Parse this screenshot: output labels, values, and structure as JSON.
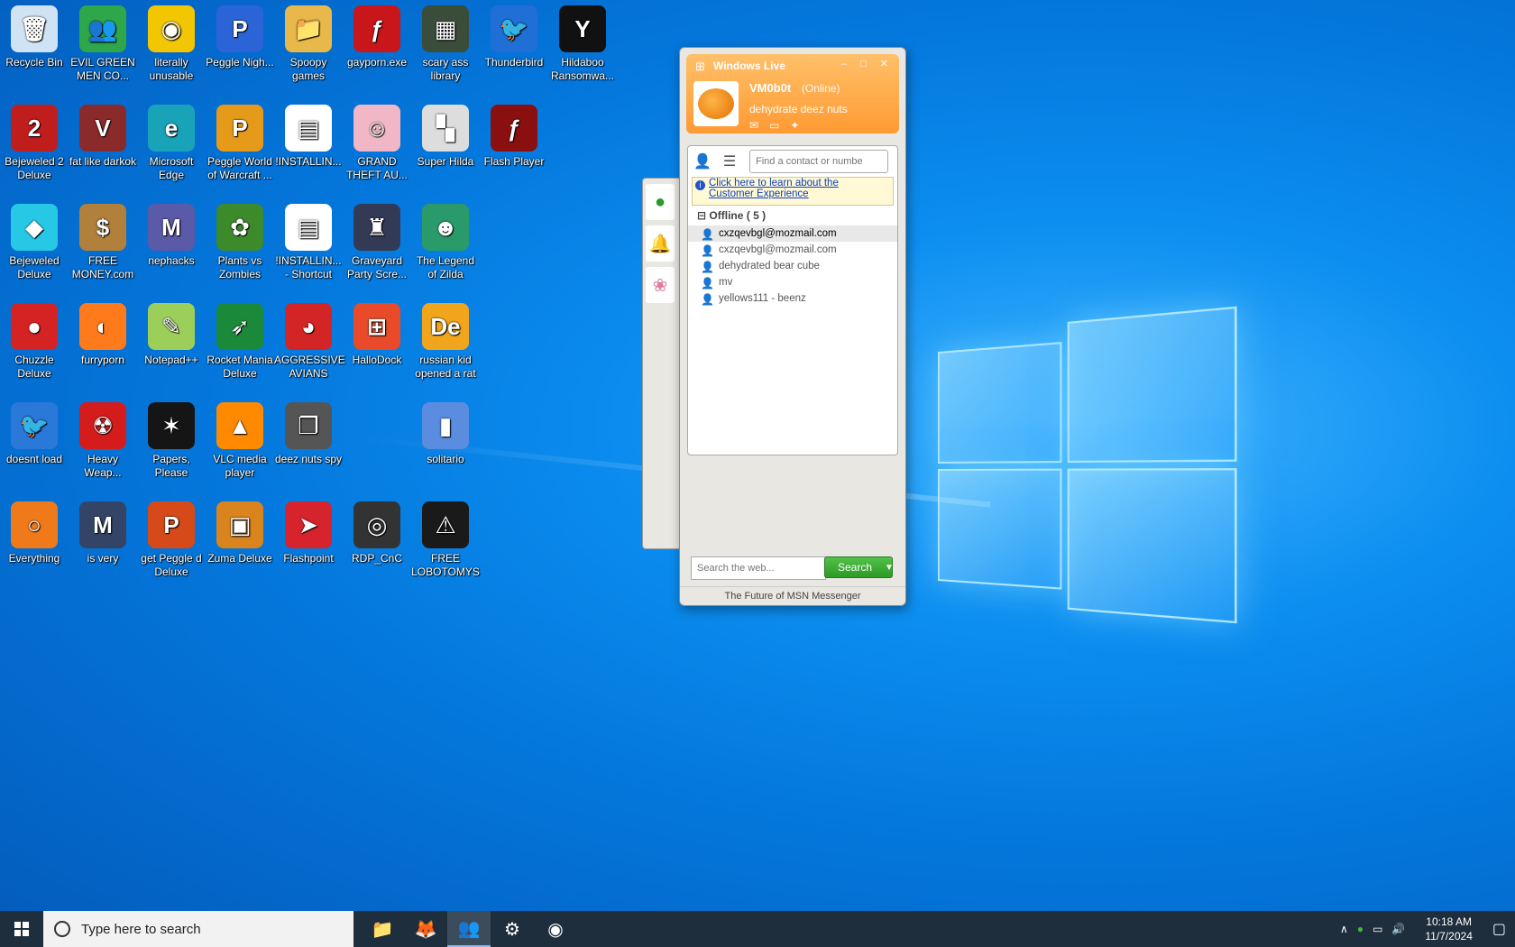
{
  "desktop": {
    "icons": [
      {
        "label": "Recycle Bin",
        "glyph": "🗑",
        "color": "#cfe3f5",
        "col": 0,
        "row": 0
      },
      {
        "label": "EVIL GREEN MEN CO...",
        "glyph": "👥",
        "color": "#2ea64a",
        "col": 1,
        "row": 0
      },
      {
        "label": "literally unusable",
        "glyph": "◉",
        "color": "#f2c600",
        "col": 2,
        "row": 0
      },
      {
        "label": "Peggle Nigh...",
        "glyph": "P",
        "color": "#2b64d6",
        "col": 3,
        "row": 0
      },
      {
        "label": "Spoopy games",
        "glyph": "📁",
        "color": "#e8b94a",
        "col": 4,
        "row": 0
      },
      {
        "label": "gayporn.exe",
        "glyph": "ƒ",
        "color": "#c8161b",
        "col": 5,
        "row": 0
      },
      {
        "label": "scary ass library",
        "glyph": "▦",
        "color": "#3a4d3a",
        "col": 6,
        "row": 0
      },
      {
        "label": "Thunderbird",
        "glyph": "🐦",
        "color": "#1f6fd6",
        "col": 7,
        "row": 0
      },
      {
        "label": "Hildaboo Ransomwa...",
        "glyph": "Y",
        "color": "#111111",
        "col": 8,
        "row": 0
      },
      {
        "label": "Bejeweled 2 Deluxe",
        "glyph": "2",
        "color": "#c01d1d",
        "col": 0,
        "row": 1
      },
      {
        "label": "fat like darkok",
        "glyph": "V",
        "color": "#8a2a2a",
        "col": 1,
        "row": 1
      },
      {
        "label": "Microsoft Edge",
        "glyph": "e",
        "color": "#19a3b8",
        "col": 2,
        "row": 1
      },
      {
        "label": "Peggle World of Warcraft ...",
        "glyph": "P",
        "color": "#e69a1a",
        "col": 3,
        "row": 1
      },
      {
        "label": "!INSTALLIN...",
        "glyph": "▤",
        "color": "#ffffff",
        "col": 4,
        "row": 1
      },
      {
        "label": "GRAND THEFT AU...",
        "glyph": "☺",
        "color": "#f2b7c6",
        "col": 5,
        "row": 1
      },
      {
        "label": "Super Hilda",
        "glyph": "▚",
        "color": "#dddddd",
        "col": 6,
        "row": 1
      },
      {
        "label": "Flash Player",
        "glyph": "ƒ",
        "color": "#8a1010",
        "col": 7,
        "row": 1
      },
      {
        "label": "Bejeweled Deluxe",
        "glyph": "◆",
        "color": "#27c8e6",
        "col": 0,
        "row": 2
      },
      {
        "label": "FREE MONEY.com",
        "glyph": "$",
        "color": "#b0803c",
        "col": 1,
        "row": 2
      },
      {
        "label": "nephacks",
        "glyph": "M",
        "color": "#5a5aa8",
        "col": 2,
        "row": 2
      },
      {
        "label": "Plants vs Zombies",
        "glyph": "✿",
        "color": "#3d8a2b",
        "col": 3,
        "row": 2
      },
      {
        "label": "!INSTALLIN... - Shortcut",
        "glyph": "▤",
        "color": "#ffffff",
        "col": 4,
        "row": 2
      },
      {
        "label": "Graveyard Party Scre...",
        "glyph": "♜",
        "color": "#333a55",
        "col": 5,
        "row": 2
      },
      {
        "label": "The Legend of Zilda",
        "glyph": "☻",
        "color": "#2b9a6a",
        "col": 6,
        "row": 2
      },
      {
        "label": "Chuzzle Deluxe",
        "glyph": "●",
        "color": "#d52323",
        "col": 0,
        "row": 3
      },
      {
        "label": "furryporn",
        "glyph": "◐",
        "color": "#ff7a1a",
        "col": 1,
        "row": 3
      },
      {
        "label": "Notepad++",
        "glyph": "✎",
        "color": "#9bcf5a",
        "col": 2,
        "row": 3
      },
      {
        "label": "Rocket Mania Deluxe",
        "glyph": "➶",
        "color": "#1a8a3a",
        "col": 3,
        "row": 3
      },
      {
        "label": "AGGRESSIVE AVIANS",
        "glyph": "◕",
        "color": "#d32525",
        "col": 4,
        "row": 3
      },
      {
        "label": "HalloDock",
        "glyph": "⊞",
        "color": "#e94b2a",
        "col": 5,
        "row": 3
      },
      {
        "label": "russian kid opened a rat",
        "glyph": "De",
        "color": "#f0a51c",
        "col": 6,
        "row": 3
      },
      {
        "label": "doesnt load",
        "glyph": "🐦",
        "color": "#2a78d8",
        "col": 0,
        "row": 4
      },
      {
        "label": "Heavy Weap...",
        "glyph": "☢",
        "color": "#d41c1c",
        "col": 1,
        "row": 4
      },
      {
        "label": "Papers, Please",
        "glyph": "✶",
        "color": "#151515",
        "col": 2,
        "row": 4
      },
      {
        "label": "VLC media player",
        "glyph": "▲",
        "color": "#ff8a00",
        "col": 3,
        "row": 4
      },
      {
        "label": "deez nuts spy",
        "glyph": "❐",
        "color": "#555555",
        "col": 4,
        "row": 4
      },
      {
        "label": "solitario",
        "glyph": "▮",
        "color": "#5a8ce0",
        "col": 6,
        "row": 4
      },
      {
        "label": "Everything",
        "glyph": "○",
        "color": "#f07a1a",
        "col": 0,
        "row": 5
      },
      {
        "label": "is very",
        "glyph": "M",
        "color": "#334466",
        "col": 1,
        "row": 5
      },
      {
        "label": "get Peggle d Deluxe",
        "glyph": "P",
        "color": "#d64a1a",
        "col": 2,
        "row": 5
      },
      {
        "label": "Zuma Deluxe",
        "glyph": "▣",
        "color": "#d9841c",
        "col": 3,
        "row": 5
      },
      {
        "label": "Flashpoint",
        "glyph": "➤",
        "color": "#d6232c",
        "col": 4,
        "row": 5
      },
      {
        "label": "RDP_CnC",
        "glyph": "◎",
        "color": "#333333",
        "col": 5,
        "row": 5
      },
      {
        "label": "FREE LOBOTOMYS",
        "glyph": "⚠",
        "color": "#1a1a1a",
        "col": 6,
        "row": 5
      }
    ]
  },
  "msn": {
    "title": "Windows Live",
    "controls": "– □ ✕",
    "username": "VM0b0t",
    "status": "(Online)",
    "personal_message": "dehydrate deez nuts",
    "find_placeholder": "Find a contact or numbe",
    "banner_line1": "Click here to learn about the",
    "banner_line2": "Customer Experience",
    "group_label": "Offline ( 5 )",
    "contacts": [
      "cxzqevbgl@mozmail.com",
      "cxzqevbgl@mozmail.com",
      "dehydrated bear cube",
      "mv",
      "yellows111 - beenz"
    ],
    "web_search_placeholder": "Search the web...",
    "search_button": "Search",
    "footer": "The Future of MSN Messenger"
  },
  "taskbar": {
    "search_placeholder": "Type here to search",
    "apps": [
      {
        "name": "file-explorer-icon",
        "glyph": "📁",
        "active": false
      },
      {
        "name": "firefox-icon",
        "glyph": "🦊",
        "active": false
      },
      {
        "name": "messenger-icon",
        "glyph": "👥",
        "active": true
      },
      {
        "name": "settings-icon",
        "glyph": "⚙",
        "active": false
      },
      {
        "name": "chrome-icon",
        "glyph": "◉",
        "active": false
      }
    ],
    "time": "10:18 AM",
    "date": "11/7/2024"
  }
}
